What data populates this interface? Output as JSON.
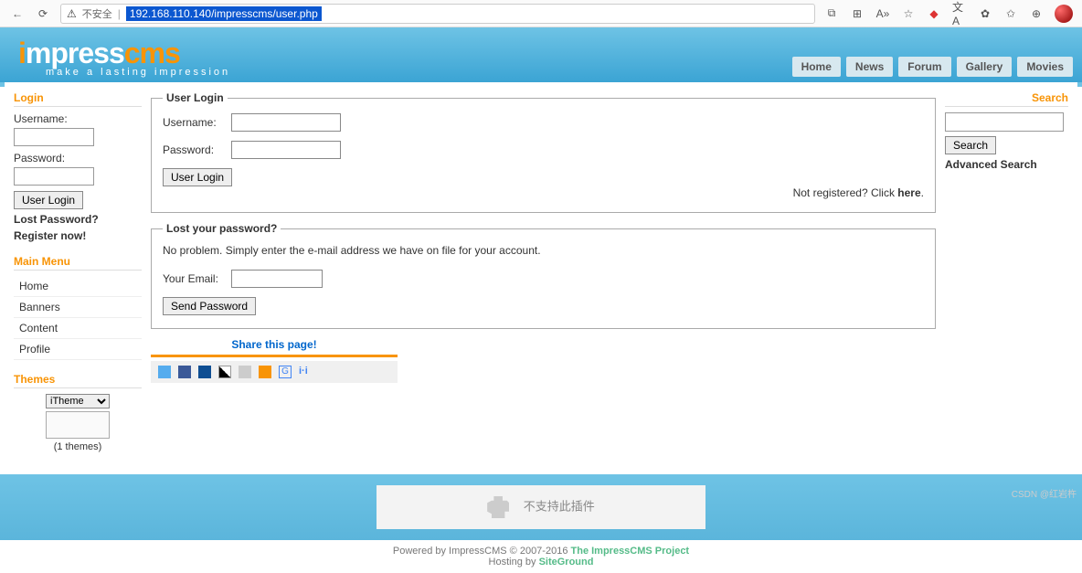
{
  "browser": {
    "security_label": "不安全",
    "url": "192.168.110.140/impresscms/user.php"
  },
  "logo": {
    "part_i": "i",
    "part_mpress": "mpress",
    "part_cms": "cms",
    "tagline": "make a lasting impression"
  },
  "nav": {
    "items": [
      {
        "label": "Home"
      },
      {
        "label": "News"
      },
      {
        "label": "Forum"
      },
      {
        "label": "Gallery"
      },
      {
        "label": "Movies"
      }
    ]
  },
  "sidebar": {
    "login_title": "Login",
    "username_label": "Username:",
    "password_label": "Password:",
    "login_button": "User Login",
    "lost_pw_link": "Lost Password?",
    "register_link": "Register now!",
    "menu_title": "Main Menu",
    "menu": [
      {
        "label": "Home"
      },
      {
        "label": "Banners"
      },
      {
        "label": "Content"
      },
      {
        "label": "Profile"
      }
    ],
    "themes_title": "Themes",
    "theme_option": "iTheme",
    "theme_count": "(1 themes)"
  },
  "main": {
    "user_login_legend": "User Login",
    "username_label": "Username:",
    "password_label": "Password:",
    "login_button": "User Login",
    "not_registered": "Not registered? Click ",
    "here_link": "here",
    "period": ".",
    "lost_legend": "Lost your password?",
    "lost_desc": "No problem. Simply enter the e-mail address we have on file for your account.",
    "email_label": "Your Email:",
    "send_button": "Send Password",
    "share_title": "Share this page!"
  },
  "search": {
    "title": "Search",
    "button": "Search",
    "advanced": "Advanced Search"
  },
  "footer": {
    "plugin_error": "不支持此插件",
    "powered_prefix": "Powered by ImpressCMS © 2007-2016 ",
    "project_link": "The ImpressCMS Project",
    "hosting_prefix": "Hosting by ",
    "hosting_link": "SiteGround"
  },
  "watermark": "CSDN @红岩杵"
}
